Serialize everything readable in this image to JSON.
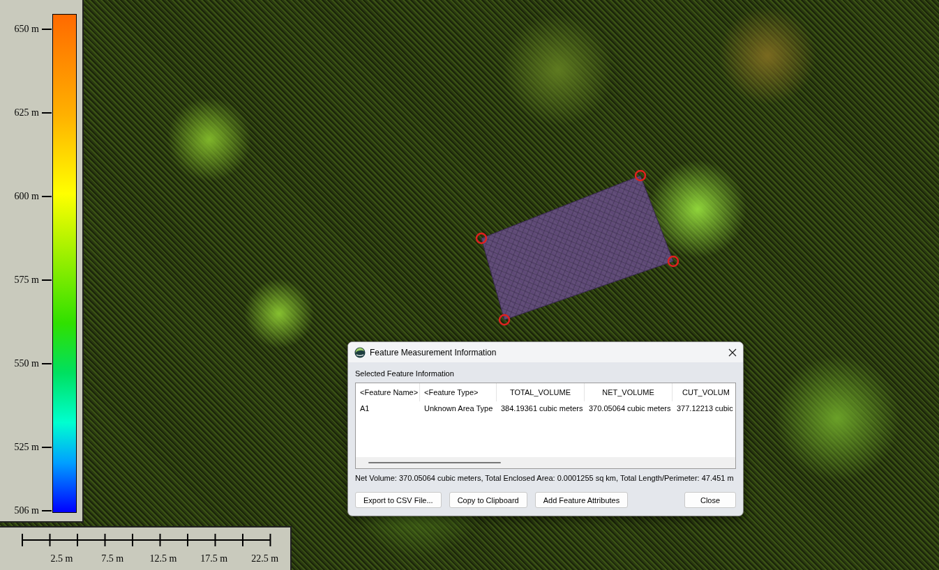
{
  "legend": {
    "ticks": [
      "650 m",
      "625 m",
      "600 m",
      "575 m",
      "550 m",
      "525 m",
      "506 m"
    ]
  },
  "scale_bar": {
    "labels": [
      "2.5 m",
      "7.5 m",
      "12.5 m",
      "17.5 m",
      "22.5 m"
    ]
  },
  "dialog": {
    "title": "Feature Measurement Information",
    "section_label": "Selected Feature Information",
    "table": {
      "columns": [
        "<Feature Name>",
        "<Feature Type>",
        "TOTAL_VOLUME",
        "NET_VOLUME",
        "CUT_VOLUM"
      ],
      "rows": [
        [
          "A1",
          "Unknown Area Type",
          "384.19361 cubic meters",
          "370.05064 cubic meters",
          "377.12213 cubic"
        ]
      ]
    },
    "summary": "Net Volume: 370.05064 cubic meters, Total Enclosed Area: 0.0001255 sq km, Total Length/Perimeter: 47.451 m",
    "buttons": [
      "Export to CSV File...",
      "Copy to Clipboard",
      "Add Feature Attributes"
    ],
    "close_button": "Close"
  }
}
